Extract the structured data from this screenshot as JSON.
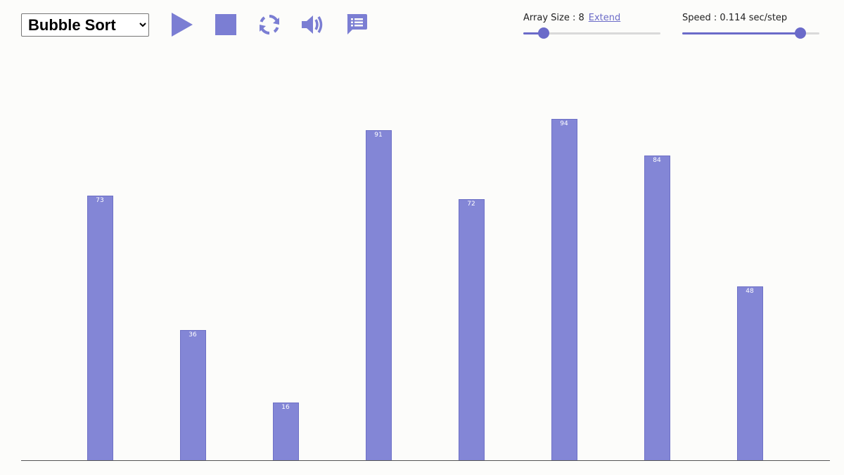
{
  "algorithm_select": {
    "selected": "Bubble Sort",
    "options": [
      "Bubble Sort"
    ]
  },
  "toolbar": {
    "play_icon": "play-icon",
    "stop_icon": "stop-icon",
    "refresh_icon": "refresh-icon",
    "sound_icon": "speaker-icon",
    "description_icon": "chat-list-icon"
  },
  "array_size": {
    "label": "Array Size : 8",
    "link": "Extend",
    "value_fraction": 0.15
  },
  "speed": {
    "label": "Speed : 0.114 sec/step",
    "value_fraction": 0.86
  },
  "colors": {
    "accent": "#6a6ac9",
    "bar": "#8386d6",
    "background": "#fcfcfa"
  },
  "chart_data": {
    "type": "bar",
    "values": [
      73,
      36,
      16,
      91,
      72,
      94,
      84,
      48
    ],
    "ylim": [
      0,
      100
    ]
  }
}
